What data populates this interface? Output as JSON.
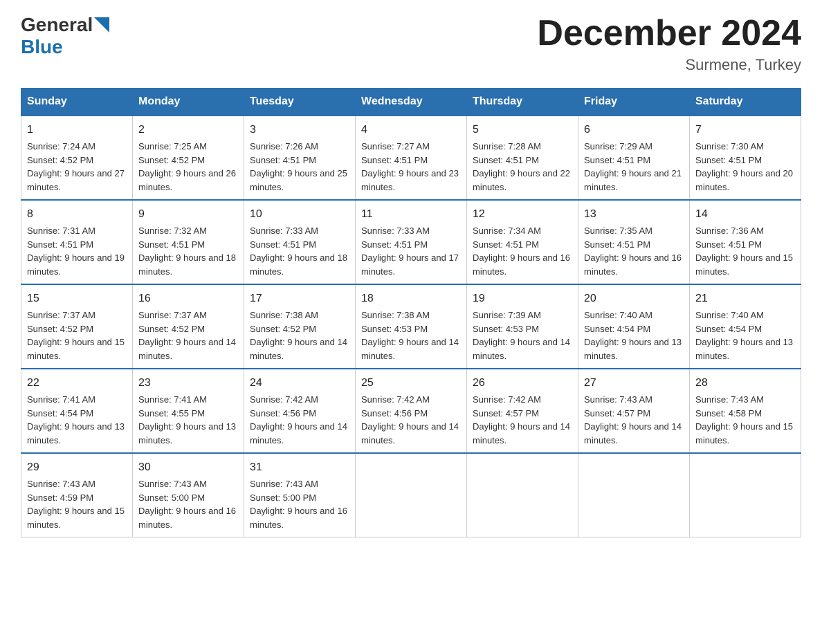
{
  "header": {
    "logo_general": "General",
    "logo_blue": "Blue",
    "month_title": "December 2024",
    "location": "Surmene, Turkey"
  },
  "days_of_week": [
    "Sunday",
    "Monday",
    "Tuesday",
    "Wednesday",
    "Thursday",
    "Friday",
    "Saturday"
  ],
  "weeks": [
    [
      {
        "day": "1",
        "sunrise": "7:24 AM",
        "sunset": "4:52 PM",
        "daylight": "9 hours and 27 minutes."
      },
      {
        "day": "2",
        "sunrise": "7:25 AM",
        "sunset": "4:52 PM",
        "daylight": "9 hours and 26 minutes."
      },
      {
        "day": "3",
        "sunrise": "7:26 AM",
        "sunset": "4:51 PM",
        "daylight": "9 hours and 25 minutes."
      },
      {
        "day": "4",
        "sunrise": "7:27 AM",
        "sunset": "4:51 PM",
        "daylight": "9 hours and 23 minutes."
      },
      {
        "day": "5",
        "sunrise": "7:28 AM",
        "sunset": "4:51 PM",
        "daylight": "9 hours and 22 minutes."
      },
      {
        "day": "6",
        "sunrise": "7:29 AM",
        "sunset": "4:51 PM",
        "daylight": "9 hours and 21 minutes."
      },
      {
        "day": "7",
        "sunrise": "7:30 AM",
        "sunset": "4:51 PM",
        "daylight": "9 hours and 20 minutes."
      }
    ],
    [
      {
        "day": "8",
        "sunrise": "7:31 AM",
        "sunset": "4:51 PM",
        "daylight": "9 hours and 19 minutes."
      },
      {
        "day": "9",
        "sunrise": "7:32 AM",
        "sunset": "4:51 PM",
        "daylight": "9 hours and 18 minutes."
      },
      {
        "day": "10",
        "sunrise": "7:33 AM",
        "sunset": "4:51 PM",
        "daylight": "9 hours and 18 minutes."
      },
      {
        "day": "11",
        "sunrise": "7:33 AM",
        "sunset": "4:51 PM",
        "daylight": "9 hours and 17 minutes."
      },
      {
        "day": "12",
        "sunrise": "7:34 AM",
        "sunset": "4:51 PM",
        "daylight": "9 hours and 16 minutes."
      },
      {
        "day": "13",
        "sunrise": "7:35 AM",
        "sunset": "4:51 PM",
        "daylight": "9 hours and 16 minutes."
      },
      {
        "day": "14",
        "sunrise": "7:36 AM",
        "sunset": "4:51 PM",
        "daylight": "9 hours and 15 minutes."
      }
    ],
    [
      {
        "day": "15",
        "sunrise": "7:37 AM",
        "sunset": "4:52 PM",
        "daylight": "9 hours and 15 minutes."
      },
      {
        "day": "16",
        "sunrise": "7:37 AM",
        "sunset": "4:52 PM",
        "daylight": "9 hours and 14 minutes."
      },
      {
        "day": "17",
        "sunrise": "7:38 AM",
        "sunset": "4:52 PM",
        "daylight": "9 hours and 14 minutes."
      },
      {
        "day": "18",
        "sunrise": "7:38 AM",
        "sunset": "4:53 PM",
        "daylight": "9 hours and 14 minutes."
      },
      {
        "day": "19",
        "sunrise": "7:39 AM",
        "sunset": "4:53 PM",
        "daylight": "9 hours and 14 minutes."
      },
      {
        "day": "20",
        "sunrise": "7:40 AM",
        "sunset": "4:54 PM",
        "daylight": "9 hours and 13 minutes."
      },
      {
        "day": "21",
        "sunrise": "7:40 AM",
        "sunset": "4:54 PM",
        "daylight": "9 hours and 13 minutes."
      }
    ],
    [
      {
        "day": "22",
        "sunrise": "7:41 AM",
        "sunset": "4:54 PM",
        "daylight": "9 hours and 13 minutes."
      },
      {
        "day": "23",
        "sunrise": "7:41 AM",
        "sunset": "4:55 PM",
        "daylight": "9 hours and 13 minutes."
      },
      {
        "day": "24",
        "sunrise": "7:42 AM",
        "sunset": "4:56 PM",
        "daylight": "9 hours and 14 minutes."
      },
      {
        "day": "25",
        "sunrise": "7:42 AM",
        "sunset": "4:56 PM",
        "daylight": "9 hours and 14 minutes."
      },
      {
        "day": "26",
        "sunrise": "7:42 AM",
        "sunset": "4:57 PM",
        "daylight": "9 hours and 14 minutes."
      },
      {
        "day": "27",
        "sunrise": "7:43 AM",
        "sunset": "4:57 PM",
        "daylight": "9 hours and 14 minutes."
      },
      {
        "day": "28",
        "sunrise": "7:43 AM",
        "sunset": "4:58 PM",
        "daylight": "9 hours and 15 minutes."
      }
    ],
    [
      {
        "day": "29",
        "sunrise": "7:43 AM",
        "sunset": "4:59 PM",
        "daylight": "9 hours and 15 minutes."
      },
      {
        "day": "30",
        "sunrise": "7:43 AM",
        "sunset": "5:00 PM",
        "daylight": "9 hours and 16 minutes."
      },
      {
        "day": "31",
        "sunrise": "7:43 AM",
        "sunset": "5:00 PM",
        "daylight": "9 hours and 16 minutes."
      },
      null,
      null,
      null,
      null
    ]
  ]
}
